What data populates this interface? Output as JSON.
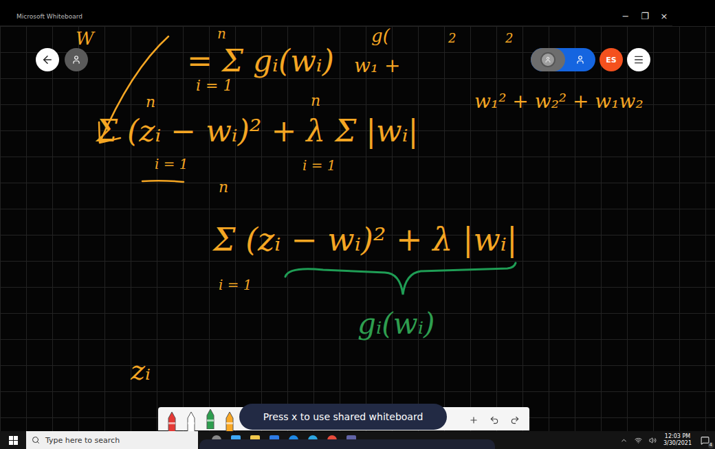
{
  "window": {
    "title": "Microsoft Whiteboard",
    "controls": [
      "−",
      "❐",
      "×"
    ]
  },
  "top_bar": {
    "participant_initials": "ES"
  },
  "ink": [
    {
      "text": "W",
      "color": "#f5a623"
    },
    {
      "text": "n",
      "color": "#f5a623"
    },
    {
      "text": "= Σ gᵢ(wᵢ)",
      "color": "#f5a623"
    },
    {
      "text": "i = 1",
      "color": "#f5a623"
    },
    {
      "text": "g(",
      "color": "#f5a623"
    },
    {
      "text": "2",
      "color": "#f5a623"
    },
    {
      "text": "2",
      "color": "#f5a623"
    },
    {
      "text": "w₁ +",
      "color": "#f5a623"
    },
    {
      "text": "n",
      "color": "#f5a623"
    },
    {
      "text": "Σ (zᵢ − wᵢ)² + λ Σ |wᵢ|",
      "color": "#f5a623"
    },
    {
      "text": "n",
      "color": "#f5a623"
    },
    {
      "text": "i = 1",
      "color": "#f5a623"
    },
    {
      "text": "i = 1",
      "color": "#f5a623"
    },
    {
      "text": "w₁² + w₂² + w₁w₂",
      "color": "#f5a623"
    },
    {
      "text": "n",
      "color": "#f5a623"
    },
    {
      "text": "Σ (zᵢ − wᵢ)² + λ |wᵢ|",
      "color": "#f5a623"
    },
    {
      "text": "i = 1",
      "color": "#f5a623"
    },
    {
      "text": "gᵢ(wᵢ)",
      "color": "#2e9e4f"
    },
    {
      "text": "zᵢ",
      "color": "#f5a623"
    }
  ],
  "pen_toolbar": {
    "pens": [
      {
        "color": "#e53935",
        "selected": false
      },
      {
        "color": "#ffffff",
        "selected": false
      },
      {
        "color": "#2e9e4f",
        "selected": true
      },
      {
        "color": "#f9a825",
        "selected": false
      }
    ]
  },
  "tooltip": "Press x to use shared whiteboard",
  "taskbar": {
    "search_placeholder": "Type here to search",
    "time": "12:03 PM",
    "date": "3/30/2021",
    "notifications": "4"
  }
}
